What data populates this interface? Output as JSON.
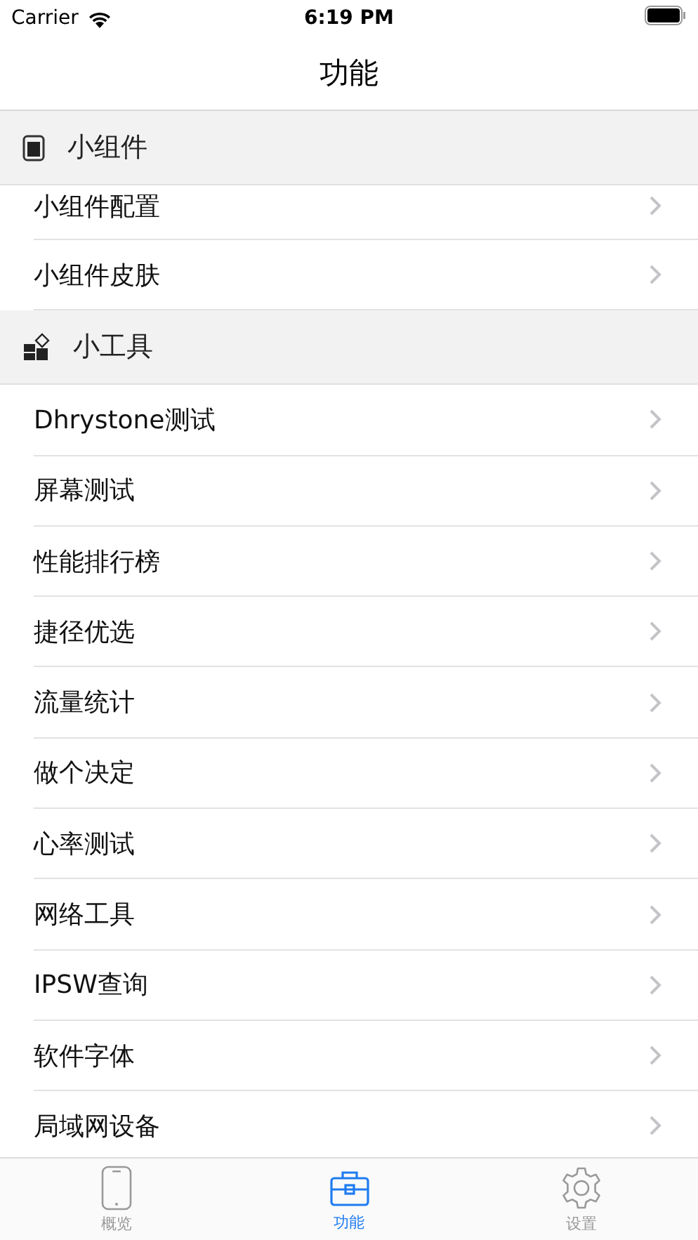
{
  "status_bar": {
    "carrier": "Carrier",
    "time": "6:19 PM"
  },
  "nav": {
    "title": "功能"
  },
  "sections": [
    {
      "kind": "widget",
      "title": "小组件",
      "items": [
        "小组件配置",
        "小组件皮肤"
      ]
    },
    {
      "kind": "tools",
      "title": "小工具",
      "items": [
        "Dhrystone测试",
        "屏幕测试",
        "性能排行榜",
        "捷径优选",
        "流量统计",
        "做个决定",
        "心率测试",
        "网络工具",
        "IPSW查询",
        "软件字体",
        "局域网设备"
      ]
    }
  ],
  "tabs": [
    {
      "kind": "phone",
      "label": "概览",
      "selected": false
    },
    {
      "kind": "box",
      "label": "功能",
      "selected": true
    },
    {
      "kind": "gear",
      "label": "设置",
      "selected": false
    }
  ]
}
